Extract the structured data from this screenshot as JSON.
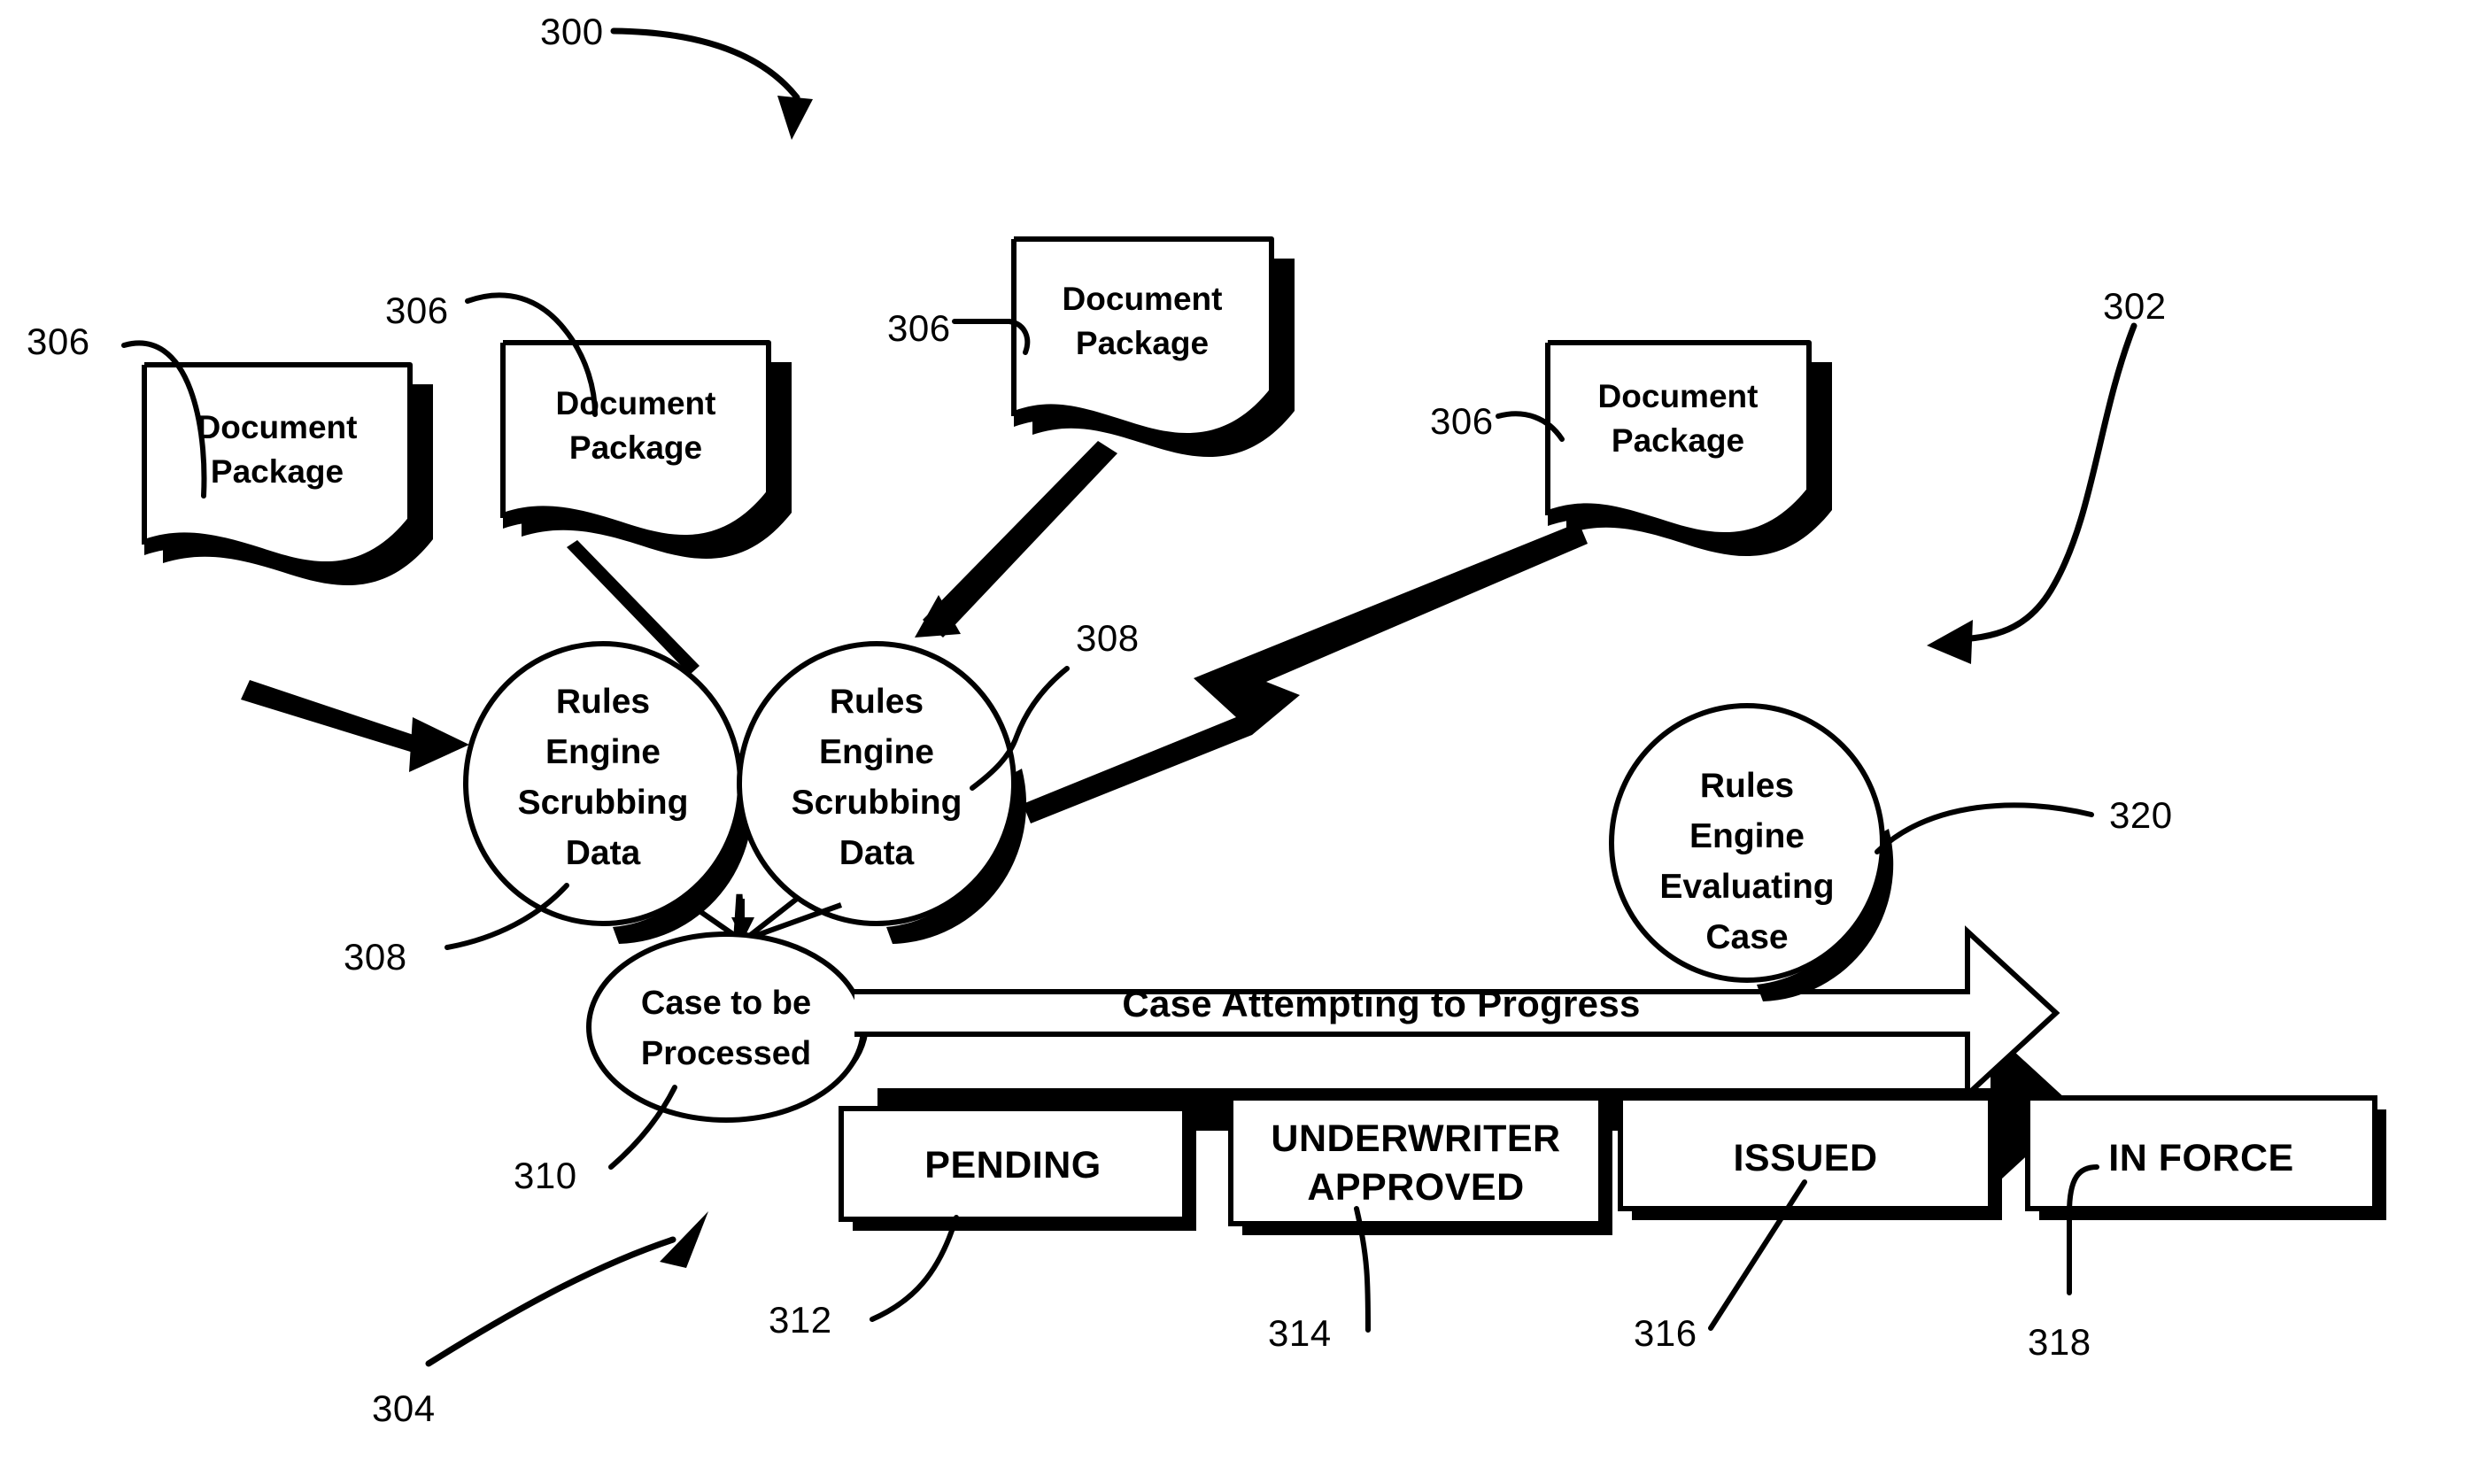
{
  "figure": {
    "number": "300",
    "type": "patent-diagram"
  },
  "reference_numerals": {
    "fig_300": "300",
    "ref_302": "302",
    "ref_304": "304",
    "ref_306_a": "306",
    "ref_306_b": "306",
    "ref_306_c": "306",
    "ref_306_d": "306",
    "ref_308_a": "308",
    "ref_308_b": "308",
    "ref_310": "310",
    "ref_312": "312",
    "ref_314": "314",
    "ref_316": "316",
    "ref_318": "318",
    "ref_320": "320"
  },
  "document_packages": [
    {
      "id": "doc-1",
      "line1": "Document",
      "line2": "Package"
    },
    {
      "id": "doc-2",
      "line1": "Document",
      "line2": "Package"
    },
    {
      "id": "doc-3",
      "line1": "Document",
      "line2": "Package"
    },
    {
      "id": "doc-4",
      "line1": "Document",
      "line2": "Package"
    }
  ],
  "rules_engines": [
    {
      "id": "scrub-1",
      "line1": "Rules",
      "line2": "Engine",
      "line3": "Scrubbing",
      "line4": "Data"
    },
    {
      "id": "scrub-2",
      "line1": "Rules",
      "line2": "Engine",
      "line3": "Scrubbing",
      "line4": "Data"
    },
    {
      "id": "evaluate",
      "line1": "Rules",
      "line2": "Engine",
      "line3": "Evaluating",
      "line4": "Case"
    }
  ],
  "case_node": {
    "line1": "Case to be",
    "line2": "Processed"
  },
  "progress_arrow": {
    "label": "Case Attempting to Progress"
  },
  "state_boxes": [
    {
      "id": "pending",
      "line1": "PENDING",
      "line2": ""
    },
    {
      "id": "approved",
      "line1": "UNDERWRITER",
      "line2": "APPROVED"
    },
    {
      "id": "issued",
      "line1": "ISSUED",
      "line2": ""
    },
    {
      "id": "inforce",
      "line1": "IN FORCE",
      "line2": ""
    }
  ],
  "colors": {
    "ink": "#000000",
    "paper": "#ffffff"
  }
}
